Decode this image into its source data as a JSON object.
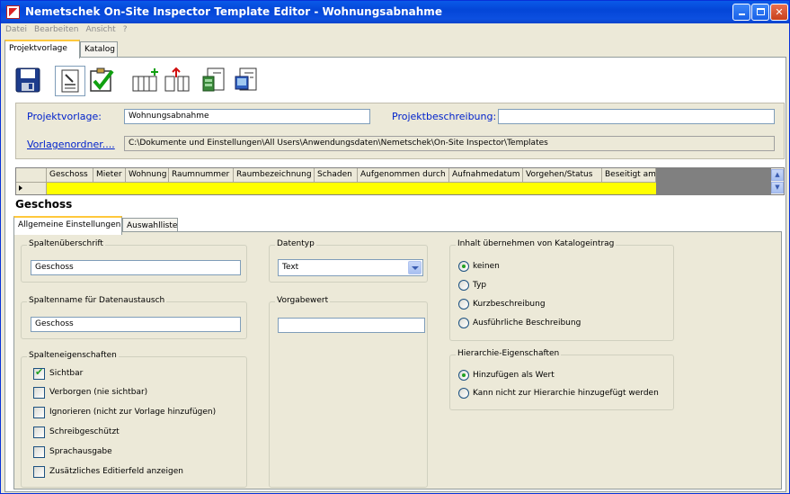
{
  "window": {
    "title": "Nemetschek On-Site Inspector Template Editor - Wohnungsabnahme"
  },
  "menu": [
    "Datei",
    "Bearbeiten",
    "Ansicht",
    "?"
  ],
  "top_tabs": [
    {
      "label": "Projektvorlage",
      "active": true
    },
    {
      "label": "Katalog",
      "active": false
    }
  ],
  "toolbar": [
    {
      "icon": "save-icon"
    },
    {
      "icon": "edit-document-icon"
    },
    {
      "icon": "check-icon"
    },
    {
      "icon": "add-column-icon"
    },
    {
      "icon": "remove-column-icon"
    },
    {
      "icon": "export-icon"
    },
    {
      "icon": "import-icon"
    }
  ],
  "project": {
    "template_label": "Projektvorlage:",
    "template_value": "Wohnungsabnahme",
    "description_label": "Projektbeschreibung:",
    "description_value": "",
    "folder_link": "Vorlagenordner....",
    "folder_path": "C:\\Dokumente und Einstellungen\\All Users\\Anwendungsdaten\\Nemetschek\\On-Site Inspector\\Templates"
  },
  "grid": {
    "columns": [
      "Geschoss",
      "Mieter",
      "Wohnung",
      "Raumnummer",
      "Raumbezeichnung",
      "Schaden",
      "Aufgenommen durch",
      "Aufnahmedatum",
      "Vorgehen/Status",
      "Beseitigt am"
    ]
  },
  "section_title": "Geschoss",
  "detail_tabs": [
    {
      "label": "Allgemeine Einstellungen",
      "active": true
    },
    {
      "label": "Auswahlliste",
      "active": false
    }
  ],
  "general": {
    "column_header_title": "Spaltenüberschrift",
    "column_header_value": "Geschoss",
    "column_name_title": "Spaltenname für Datenaustausch",
    "column_name_value": "Geschoss",
    "properties_title": "Spalteneigenschaften",
    "properties": [
      {
        "label": "Sichtbar",
        "checked": true
      },
      {
        "label": "Verborgen (nie sichtbar)",
        "checked": false
      },
      {
        "label": "Ignorieren (nicht zur Vorlage hinzufügen)",
        "checked": false
      },
      {
        "label": "Schreibgeschützt",
        "checked": false
      },
      {
        "label": "Sprachausgabe",
        "checked": false
      },
      {
        "label": "Zusätzliches Editierfeld anzeigen",
        "checked": false
      }
    ],
    "datatype_title": "Datentyp",
    "datatype_value": "Text",
    "default_title": "Vorgabewert",
    "default_value": "",
    "catalog_title": "Inhalt übernehmen von Katalogeintrag",
    "catalog_options": [
      {
        "label": "keinen",
        "selected": true
      },
      {
        "label": "Typ",
        "selected": false
      },
      {
        "label": "Kurzbeschreibung",
        "selected": false
      },
      {
        "label": "Ausführliche Beschreibung",
        "selected": false
      }
    ],
    "hierarchy_title": "Hierarchie-Eigenschaften",
    "hierarchy_options": [
      {
        "label": "Hinzufügen als Wert",
        "selected": true
      },
      {
        "label": "Kann nicht zur Hierarchie hinzugefügt werden",
        "selected": false
      }
    ]
  }
}
